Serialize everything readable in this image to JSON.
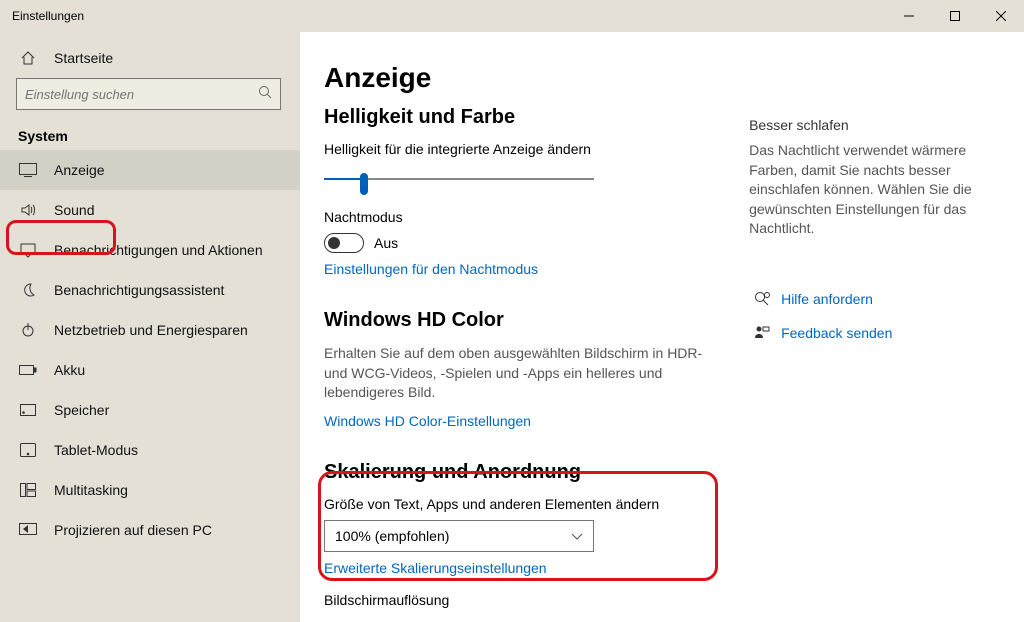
{
  "window": {
    "title": "Einstellungen"
  },
  "sidebar": {
    "home": "Startseite",
    "search_placeholder": "Einstellung suchen",
    "category": "System",
    "items": [
      {
        "label": "Anzeige",
        "icon": "display-icon",
        "selected": true
      },
      {
        "label": "Sound",
        "icon": "sound-icon"
      },
      {
        "label": "Benachrichtigungen und Aktionen",
        "icon": "notify-icon"
      },
      {
        "label": "Benachrichtigungsassistent",
        "icon": "moon-icon"
      },
      {
        "label": "Netzbetrieb und Energiesparen",
        "icon": "power-icon"
      },
      {
        "label": "Akku",
        "icon": "battery-icon"
      },
      {
        "label": "Speicher",
        "icon": "storage-icon"
      },
      {
        "label": "Tablet-Modus",
        "icon": "tablet-icon"
      },
      {
        "label": "Multitasking",
        "icon": "multitask-icon"
      },
      {
        "label": "Projizieren auf diesen PC",
        "icon": "project-icon"
      }
    ]
  },
  "main": {
    "heading": "Anzeige",
    "brightness": {
      "title": "Helligkeit und Farbe",
      "label": "Helligkeit für die integrierte Anzeige ändern",
      "nightmode_label": "Nachtmodus",
      "toggle_state": "Aus",
      "nightmode_link": "Einstellungen für den Nachtmodus"
    },
    "hdcolor": {
      "title": "Windows HD Color",
      "desc": "Erhalten Sie auf dem oben ausgewählten Bildschirm in HDR- und WCG-Videos, -Spielen und -Apps ein helleres und lebendigeres Bild.",
      "link": "Windows HD Color-Einstellungen"
    },
    "scaling": {
      "title": "Skalierung und Anordnung",
      "label": "Größe von Text, Apps und anderen Elementen ändern",
      "value": "100% (empfohlen)",
      "link": "Erweiterte Skalierungseinstellungen",
      "res_label": "Bildschirmauflösung"
    }
  },
  "aside": {
    "cut_title": "Besser schlafen",
    "desc": "Das Nachtlicht verwendet wärmere Farben, damit Sie nachts besser einschlafen können. Wählen Sie die gewünschten Einstellungen für das Nachtlicht.",
    "help": "Hilfe anfordern",
    "feedback": "Feedback senden"
  }
}
